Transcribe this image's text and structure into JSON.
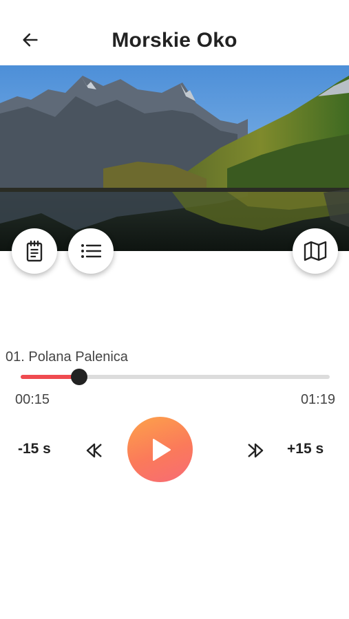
{
  "header": {
    "title": "Morskie Oko",
    "back_icon": "arrow-left-icon"
  },
  "hero": {
    "description_icon": "mountain-lake-photo",
    "actions": [
      {
        "name": "notes",
        "icon": "notepad-icon"
      },
      {
        "name": "playlist",
        "icon": "list-icon"
      },
      {
        "name": "map",
        "icon": "map-icon"
      }
    ]
  },
  "player": {
    "track_title": "01. Polana Palenica",
    "current_time": "00:15",
    "total_time": "01:19",
    "progress": 0.19,
    "rewind_label": "-15 s",
    "forward_label": "+15 s",
    "play_icon": "play-icon",
    "previous_icon": "previous-icon",
    "next_icon": "next-icon",
    "colors": {
      "progress_fill": "#ef4b50",
      "play_gradient_start": "#fca24a",
      "play_gradient_end": "#f76b75"
    }
  }
}
